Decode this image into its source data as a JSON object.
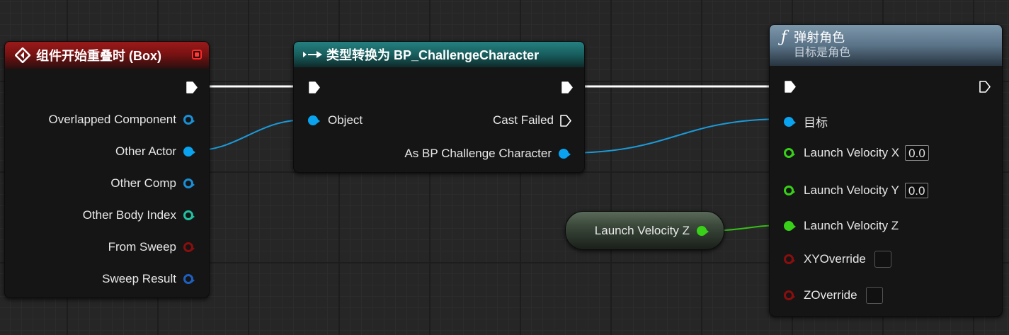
{
  "colors": {
    "exec": "#ffffff",
    "object": "#0aa3f0",
    "struct_blue": "#1a8fd6",
    "int_teal": "#20c0a0",
    "bool_red": "#a01010",
    "hitresult_blue": "#1e60c0",
    "float_green": "#38d018",
    "event_header": "#8c1414",
    "cast_header": "#1c6a6a",
    "function_header": "#6e8aa0"
  },
  "event_node": {
    "icon": "event-diamond-icon",
    "title": "组件开始重叠时 (Box)",
    "pins": [
      {
        "label": "Overlapped Component",
        "type": "object-outline"
      },
      {
        "label": "Other Actor",
        "type": "object-filled"
      },
      {
        "label": "Other Comp",
        "type": "object-outline"
      },
      {
        "label": "Other Body Index",
        "type": "int-outline"
      },
      {
        "label": "From Sweep",
        "type": "bool-outline"
      },
      {
        "label": "Sweep Result",
        "type": "struct-outline"
      }
    ]
  },
  "cast_node": {
    "icon": "cast-arrow-icon",
    "title": "类型转换为 BP_ChallengeCharacter",
    "input_object": "Object",
    "cast_failed": "Cast Failed",
    "as_output": "As BP Challenge Character"
  },
  "function_node": {
    "icon": "function-f-icon",
    "title": "弹射角色",
    "subtitle": "目标是角色",
    "target": "目标",
    "launch_x": {
      "label": "Launch Velocity X",
      "value": "0.0"
    },
    "launch_y": {
      "label": "Launch Velocity Y",
      "value": "0.0"
    },
    "launch_z": {
      "label": "Launch Velocity Z"
    },
    "xy_override": {
      "label": "XYOverride",
      "checked": false
    },
    "z_override": {
      "label": "ZOverride",
      "checked": false
    }
  },
  "variable_node": {
    "label": "Launch Velocity Z"
  }
}
